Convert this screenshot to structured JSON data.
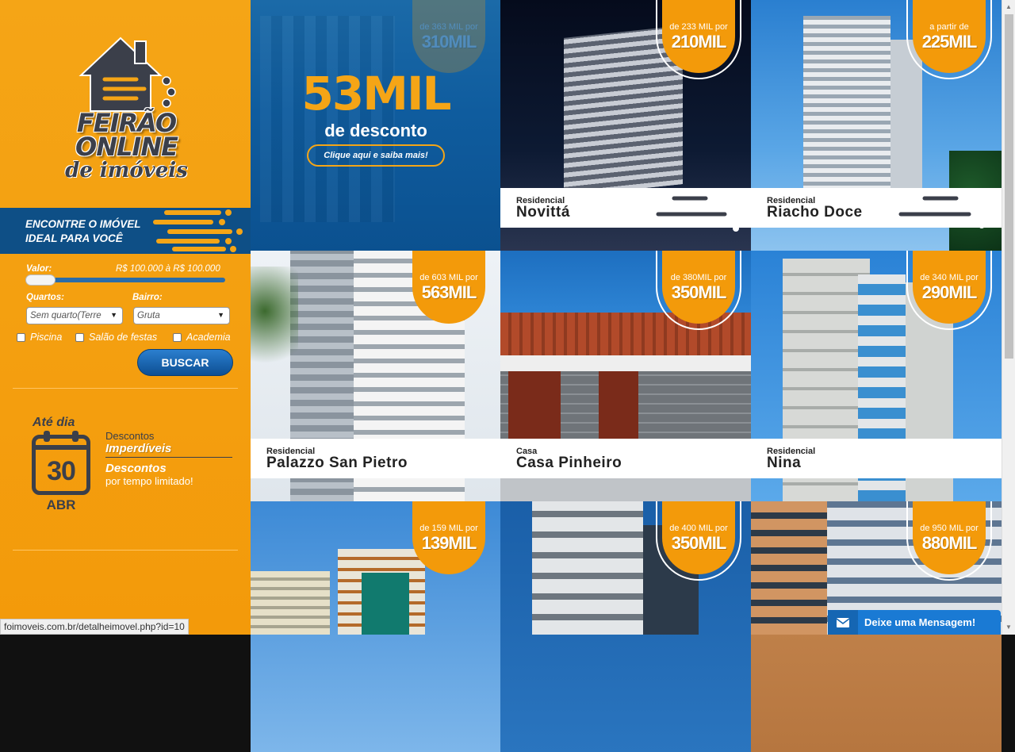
{
  "sidebar": {
    "logo": {
      "line1": "FEIRÃO",
      "line2": "ONLINE",
      "line3": "de imóveis"
    },
    "banner": {
      "line1": "ENCONTRE O IMÓVEL",
      "line2": "IDEAL PARA VOCÊ"
    },
    "filters": {
      "valor_label": "Valor:",
      "valor_range": "R$ 100.000 à R$ 100.000",
      "slider_level": 0,
      "quartos_label": "Quartos:",
      "quartos_value": "Sem quarto(Terre",
      "bairro_label": "Bairro:",
      "bairro_value": "Gruta",
      "checks": [
        "Piscina",
        "Salão de festas",
        "Academia"
      ],
      "search_button": "BUSCAR"
    },
    "promo": {
      "until": "Até dia",
      "day": "30",
      "month": "ABR",
      "line1": "Descontos",
      "line2": "Imperdíveis",
      "line3": "Descontos",
      "line4": "por tempo limitado!"
    }
  },
  "hero": {
    "faded_small": "de 363 MIL por",
    "faded_big": "310MIL",
    "big": "53MIL",
    "sub": "de desconto",
    "button": "Clique aqui e saiba mais!"
  },
  "listings": [
    {
      "price_small": "de 233 MIL por",
      "price_big": "210MIL",
      "kind": "Residencial",
      "name": "Novittá"
    },
    {
      "price_small": "a partir de",
      "price_big": "225MIL",
      "kind": "Residencial",
      "name": "Riacho Doce"
    },
    {
      "price_small": "de 603 MIL por",
      "price_big": "563MIL",
      "kind": "Residencial",
      "name": "Palazzo San Pietro"
    },
    {
      "price_small": "de 380MIL por",
      "price_big": "350MIL",
      "kind": "Casa",
      "name": "Casa Pinheiro"
    },
    {
      "price_small": "de 340 MIL por",
      "price_big": "290MIL",
      "kind": "Residencial",
      "name": "Nina"
    },
    {
      "price_small": "de 159 MIL por",
      "price_big": "139MIL"
    },
    {
      "price_small": "de 400 MIL por",
      "price_big": "350MIL"
    },
    {
      "price_small": "de 950 MIL por",
      "price_big": "880MIL"
    }
  ],
  "status_url": "foimoveis.com.br/detalheimovel.php?id=10",
  "chat_label": "Deixe uma Mensagem!",
  "colors": {
    "accent": "#f39a0a",
    "brand_blue": "#0e4f86",
    "dark": "#3b3f4a"
  }
}
